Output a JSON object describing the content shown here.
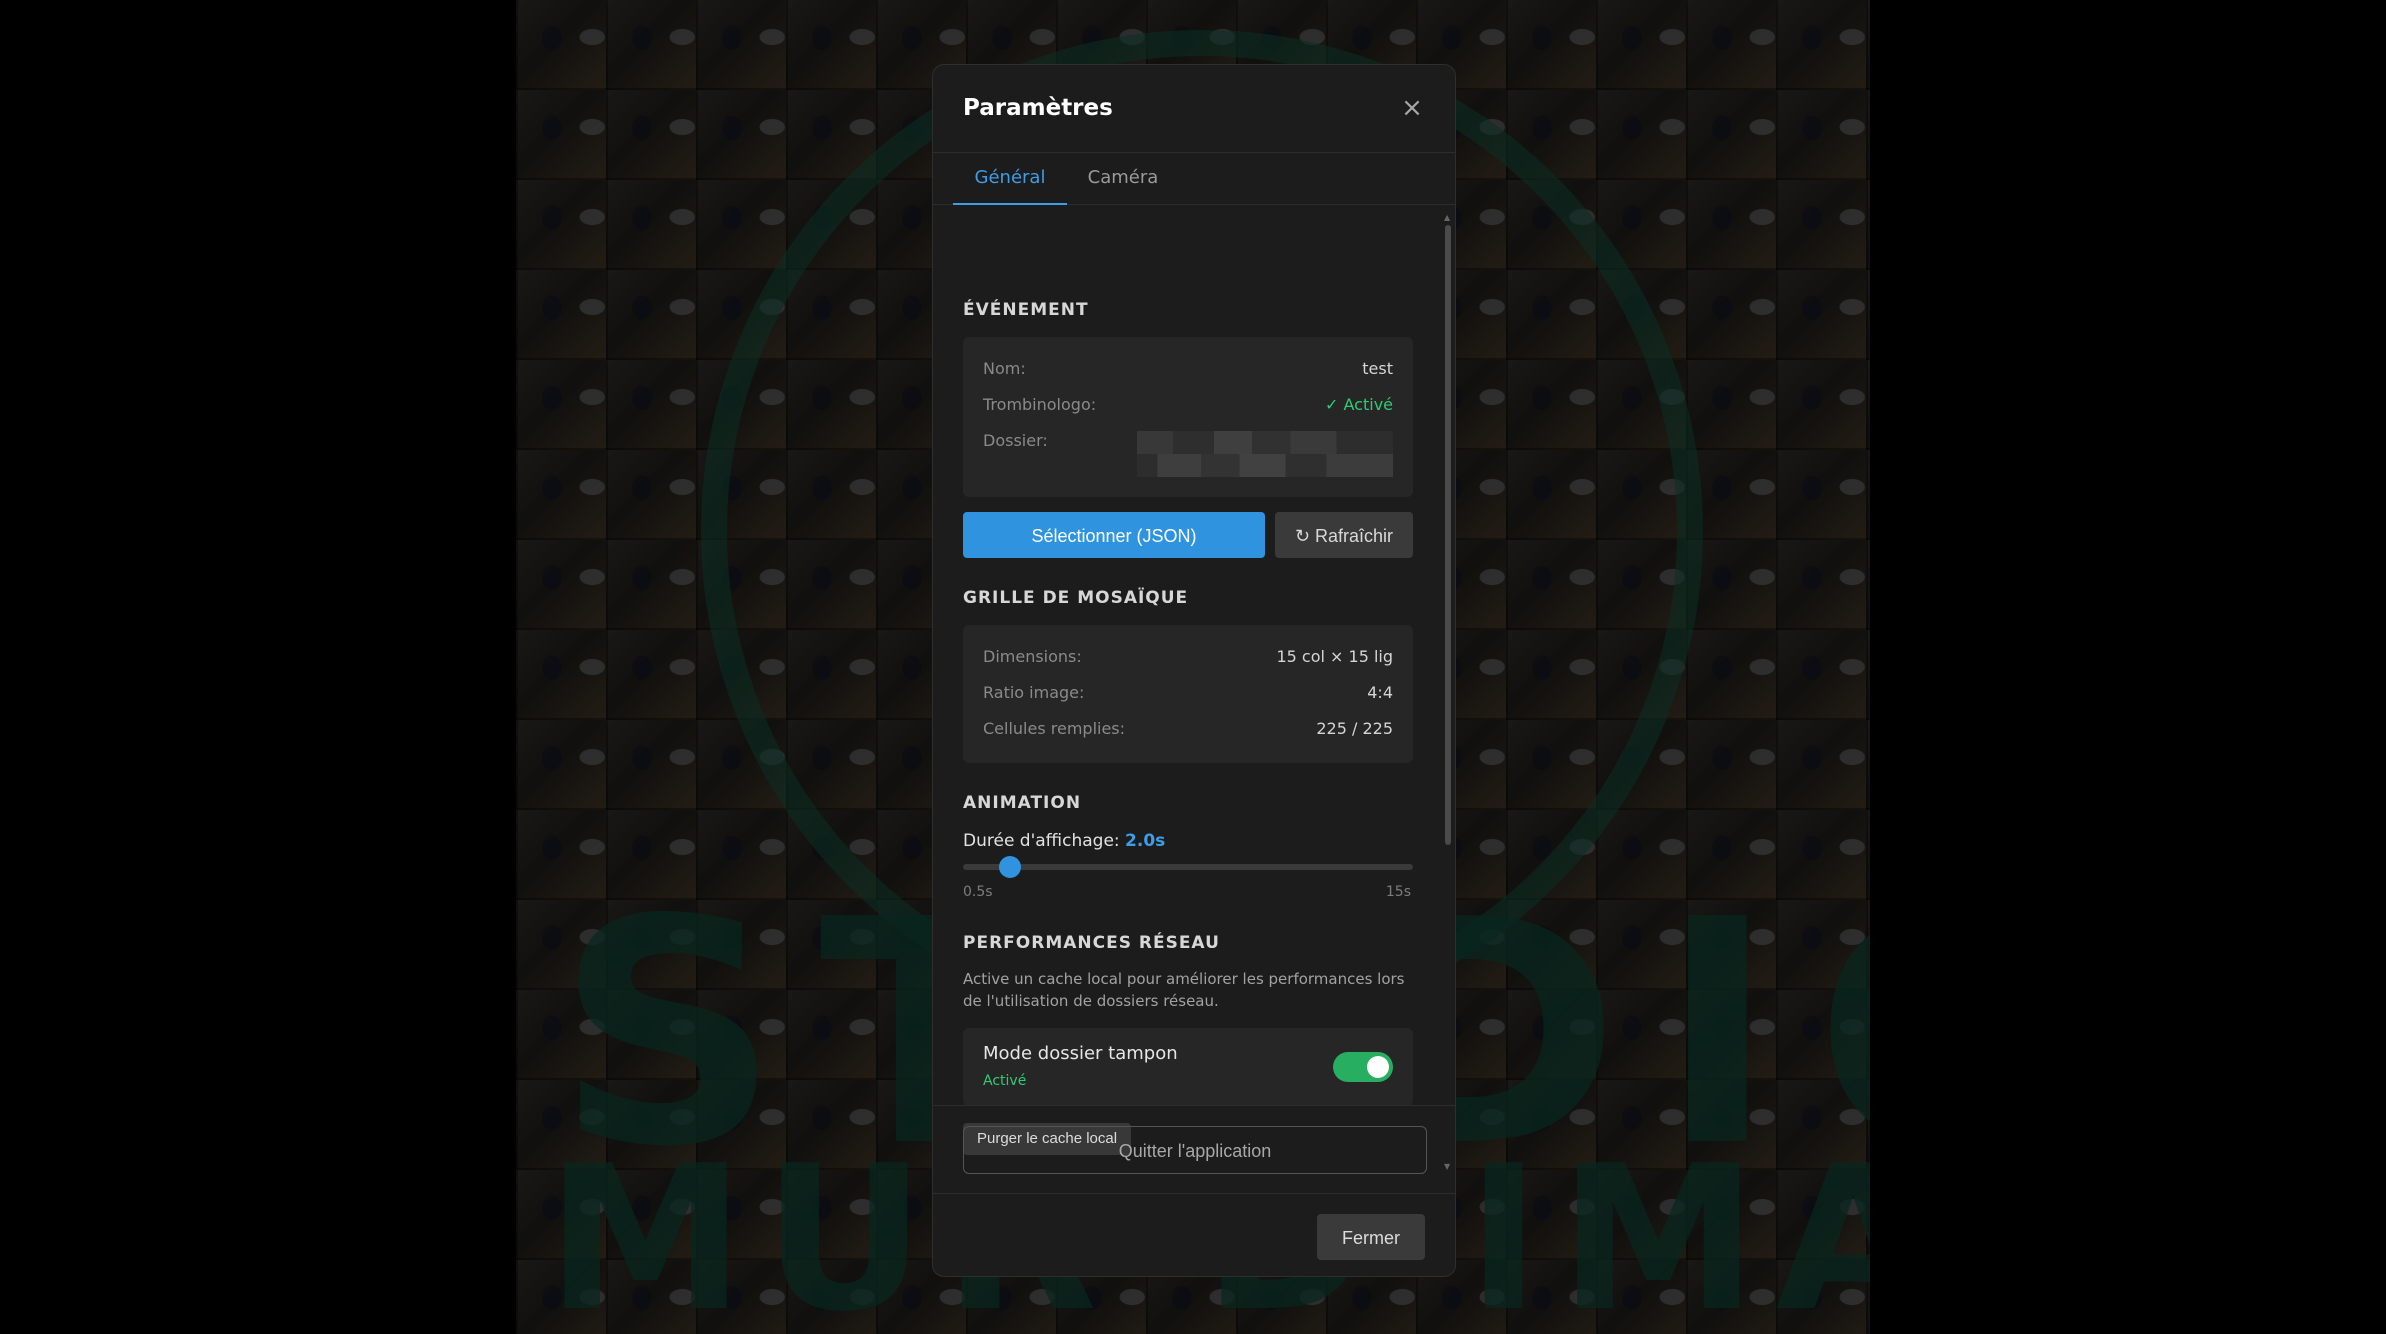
{
  "background": {
    "word_top": "STUDIO",
    "word_bottom": "MUR D'IMAGE"
  },
  "modal": {
    "title": "Paramètres",
    "close_icon": "×",
    "tabs": [
      {
        "label": "Général",
        "active": true
      },
      {
        "label": "Caméra",
        "active": false
      }
    ]
  },
  "event": {
    "title": "ÉVÉNEMENT",
    "rows": [
      {
        "label": "Nom:",
        "value": "test"
      },
      {
        "label": "Trombinologo:",
        "value": "✓ Activé"
      },
      {
        "label": "Dossier:",
        "value": ""
      }
    ],
    "select_button": "Sélectionner (JSON)",
    "refresh_button": "↻ Rafraîchir"
  },
  "grid": {
    "title": "GRILLE DE MOSAÏQUE",
    "rows": [
      {
        "label": "Dimensions:",
        "value": "15 col × 15 lig"
      },
      {
        "label": "Ratio image:",
        "value": "4:4"
      },
      {
        "label": "Cellules remplies:",
        "value": "225 / 225"
      }
    ]
  },
  "animation": {
    "title": "ANIMATION",
    "duration_label": "Durée d'affichage:",
    "duration_value": "2.0s",
    "slider": {
      "min": 0.5,
      "max": 15,
      "value": 2.0
    },
    "min_label": "0.5s",
    "max_label": "15s"
  },
  "network": {
    "title": "PERFORMANCES RÉSEAU",
    "description": "Active un cache local pour améliorer les performances lors de l'utilisation de dossiers réseau.",
    "toggle_title": "Mode dossier tampon",
    "toggle_status": "Activé",
    "toggle_on": true,
    "purge_button": "Purger le cache local"
  },
  "quit_button": "Quitter l'application",
  "close_button": "Fermer",
  "colors": {
    "accent": "#2f93e0",
    "success": "#2ecc71",
    "modal_bg": "#1c1c1c",
    "card_bg": "#262626"
  }
}
